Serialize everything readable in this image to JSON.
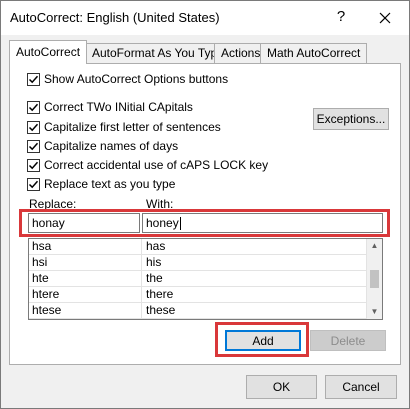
{
  "window": {
    "title": "AutoCorrect: English (United States)",
    "help_symbol": "?"
  },
  "tabs": [
    {
      "label": "AutoCorrect",
      "active": true
    },
    {
      "label": "AutoFormat As You Type",
      "active": false
    },
    {
      "label": "Actions",
      "active": false
    },
    {
      "label": "Math AutoCorrect",
      "active": false
    }
  ],
  "options": {
    "show_buttons": "Show AutoCorrect Options buttons",
    "correct_two_initial": "Correct TWo INitial CApitals",
    "capitalize_first": "Capitalize first letter of sentences",
    "capitalize_days": "Capitalize names of days",
    "correct_caps_lock": "Correct accidental use of cAPS LOCK key",
    "replace_text": "Replace text as you type"
  },
  "exceptions_label": "Exceptions...",
  "replace": {
    "replace_label": "Replace:",
    "with_label": "With:",
    "replace_value": "honay",
    "with_value": "honey"
  },
  "list": [
    {
      "from": "hsa",
      "to": "has"
    },
    {
      "from": "hsi",
      "to": "his"
    },
    {
      "from": "hte",
      "to": "the"
    },
    {
      "from": "htere",
      "to": "there"
    },
    {
      "from": "htese",
      "to": "these"
    }
  ],
  "buttons": {
    "add": "Add",
    "delete": "Delete",
    "ok": "OK",
    "cancel": "Cancel"
  },
  "colors": {
    "highlight": "#d9383a",
    "accent": "#0078d7"
  }
}
